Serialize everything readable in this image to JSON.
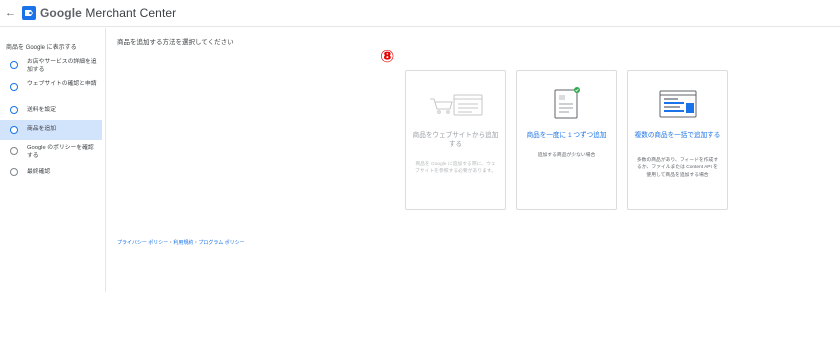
{
  "header": {
    "back_icon": "arrow-back-icon",
    "logo_icon": "google-merchant-center-logo",
    "title_brand": "Google",
    "title_product": " Merchant Center"
  },
  "sidebar": {
    "heading": "商品を Google に表示する",
    "steps": [
      {
        "label": "お店やサービスの詳細を追加する",
        "state": "incomplete"
      },
      {
        "label": "ウェブサイトの確認と申請",
        "state": "incomplete"
      },
      {
        "label": "送料を設定",
        "state": "incomplete"
      },
      {
        "label": "商品を追加",
        "state": "active"
      },
      {
        "label": "Google のポリシーを確認する",
        "state": "inactive"
      },
      {
        "label": "最終確認",
        "state": "inactive"
      }
    ]
  },
  "main": {
    "heading": "商品を追加する方法を選択してください",
    "annotation_marker": "⑧",
    "cards": [
      {
        "title": "商品をウェブサイトから追加する",
        "description": "商品を Google に追加する際に、ウェブサイトを参照する必要があります。",
        "enabled": false,
        "icon": "web-store-illustration"
      },
      {
        "title": "商品を一度に 1 つずつ追加",
        "description": "追加する商品が少ない場合",
        "enabled": true,
        "icon": "single-product-form-illustration"
      },
      {
        "title": "複数の商品を一括で追加する",
        "description": "多数の商品があり、フィードを作成するか、ファイルまたは Content API を使用して商品を追加する場合",
        "enabled": true,
        "icon": "bulk-upload-illustration"
      }
    ]
  },
  "footer": {
    "links": [
      "プライバシー ポリシー",
      "利用規約",
      "プログラム ポリシー"
    ],
    "separator": "・"
  },
  "colors": {
    "accent": "#1a73e8",
    "active_step_bg": "#d2e3fc",
    "marker": "#e60000",
    "disabled_text": "#9aa0a6"
  }
}
